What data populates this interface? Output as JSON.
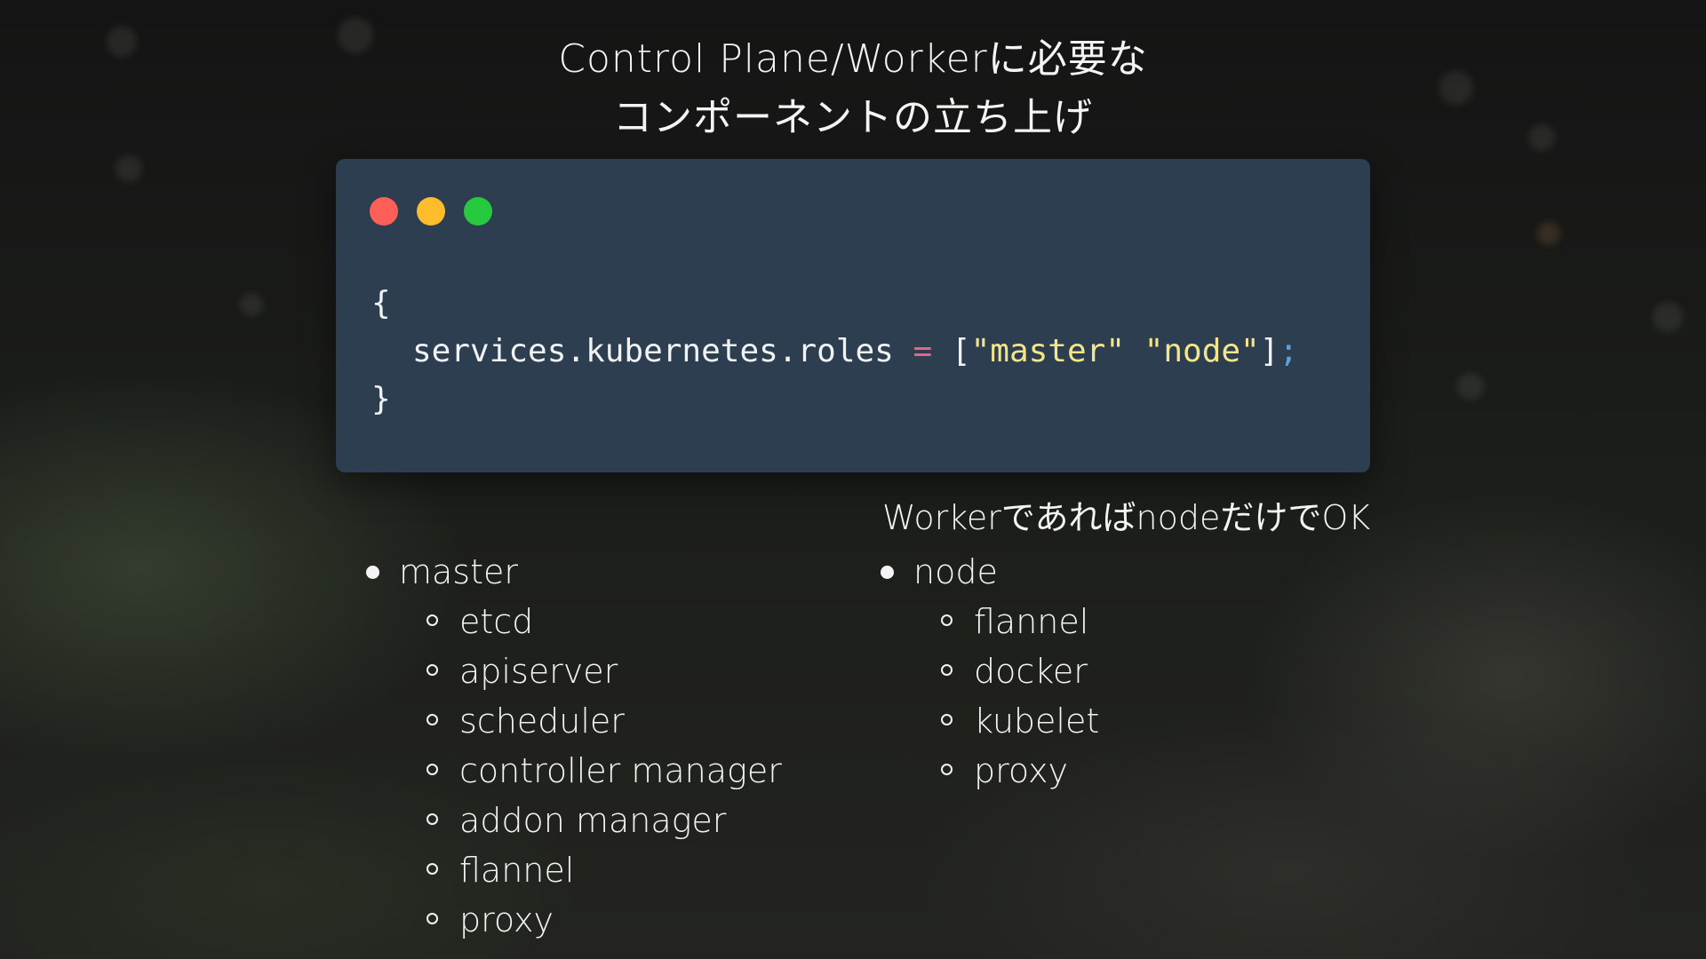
{
  "title": {
    "line1": "Control Plane/Workerに必要な",
    "line2": "コンポーネントの立ち上げ"
  },
  "code_window": {
    "traffic_lights": [
      "#ff5f56",
      "#ffbd2e",
      "#27c93f"
    ],
    "line1": "{",
    "line2": {
      "key": "services.kubernetes.roles",
      "op": "=",
      "open": "[",
      "value1": "\"master\"",
      "value2": "\"node\"",
      "close": "]",
      "semi": ";"
    },
    "line3": "}"
  },
  "note": "WorkerであればnodeだけでOK",
  "master": {
    "label": "master",
    "items": [
      "etcd",
      "apiserver",
      "scheduler",
      "controller manager",
      "addon manager",
      "flannel",
      "proxy"
    ]
  },
  "node": {
    "label": "node",
    "items": [
      "flannel",
      "docker",
      "kubelet",
      "proxy"
    ]
  }
}
